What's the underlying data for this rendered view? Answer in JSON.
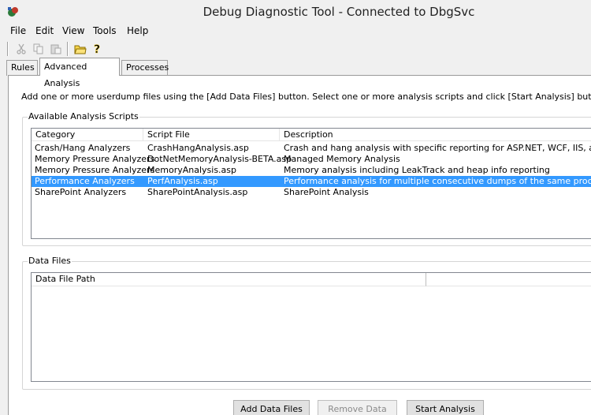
{
  "window": {
    "title": "Debug Diagnostic Tool - Connected to DbgSvc"
  },
  "menu": [
    "File",
    "Edit",
    "View",
    "Tools",
    "Help"
  ],
  "toolbar": {
    "buttons": [
      "cut-icon",
      "copy-icon",
      "paste-icon",
      "open-folder-icon",
      "help-icon"
    ]
  },
  "tabs": [
    "Rules",
    "Advanced Analysis",
    "Processes"
  ],
  "active_tab": "Advanced Analysis",
  "instructions": "Add one or more userdump files using the [Add Data Files] button. Select one or more analysis scripts and click [Start Analysis] button.",
  "scripts": {
    "group_label": "Available Analysis Scripts",
    "columns": [
      "Category",
      "Script File",
      "Description"
    ],
    "rows": [
      {
        "category": "Crash/Hang Analyzers",
        "file": "CrashHangAnalysis.asp",
        "description": "Crash and hang analysis with specific reporting for ASP.NET, WCF, IIS, and more"
      },
      {
        "category": "Memory Pressure Analyzers",
        "file": "DotNetMemoryAnalysis-BETA.asp",
        "description": "Managed Memory Analysis"
      },
      {
        "category": "Memory Pressure Analyzers",
        "file": "MemoryAnalysis.asp",
        "description": "Memory analysis including LeakTrack and heap info reporting"
      },
      {
        "category": "Performance Analyzers",
        "file": "PerfAnalysis.asp",
        "description": "Performance analysis for multiple consecutive dumps of the same process"
      },
      {
        "category": "SharePoint Analyzers",
        "file": "SharePointAnalysis.asp",
        "description": "SharePoint Analysis"
      }
    ],
    "selected_row": "Performance Analyzers"
  },
  "data_files": {
    "group_label": "Data Files",
    "columns": [
      "Data File Path",
      ""
    ]
  },
  "buttons": {
    "add": "Add Data Files",
    "remove": "Remove Data Files",
    "start": "Start Analysis"
  },
  "colors": {
    "selection": "#3399ff",
    "window_bg": "#f0f0f0"
  }
}
